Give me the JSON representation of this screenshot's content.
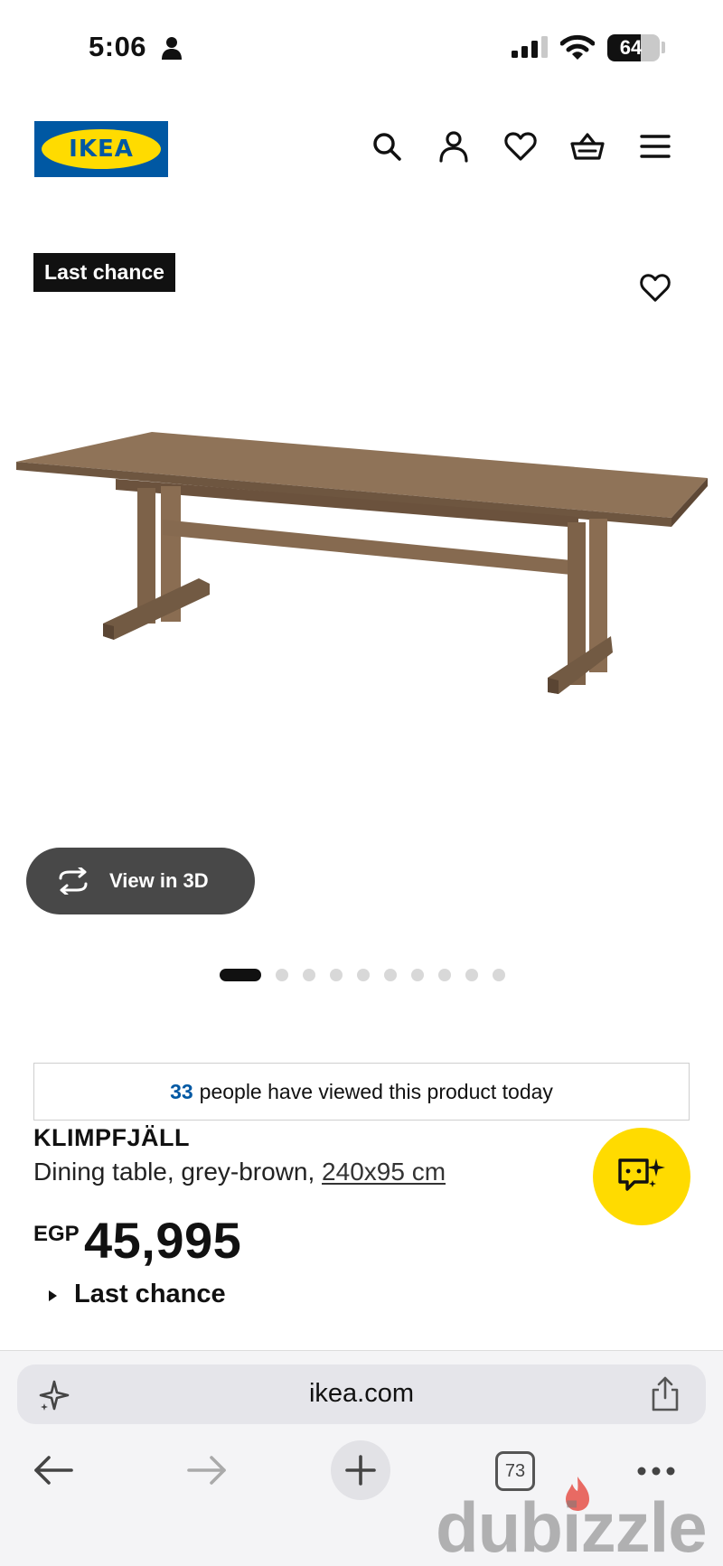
{
  "status_bar": {
    "time": "5:06",
    "battery_level": "64",
    "icons": [
      "person-icon",
      "signal-icon",
      "wifi-icon",
      "battery-icon"
    ]
  },
  "header": {
    "logo_text": "IKEA",
    "brand_colors": {
      "blue": "#0058a3",
      "yellow": "#ffdb00"
    },
    "icons": [
      "search-icon",
      "account-icon",
      "heart-icon",
      "basket-icon",
      "menu-icon"
    ]
  },
  "gallery": {
    "badge": "Last chance",
    "view_3d_label": "View in 3D",
    "image_count": 10,
    "active_image": 1
  },
  "product": {
    "viewed_count": "33",
    "viewed_text": "people have viewed this product today",
    "name": "KLIMPFJÄLL",
    "description": "Dining table, grey-brown, ",
    "size_link": "240x95 cm",
    "currency": "EGP",
    "price": "45,995",
    "availability": "Last chance"
  },
  "browser": {
    "url": "ikea.com",
    "tab_count": "73",
    "icons": [
      "sparkle-icon",
      "share-icon",
      "back-arrow-icon",
      "forward-arrow-icon",
      "plus-icon",
      "more-icon"
    ]
  },
  "watermark": {
    "text": "dubizzle"
  }
}
